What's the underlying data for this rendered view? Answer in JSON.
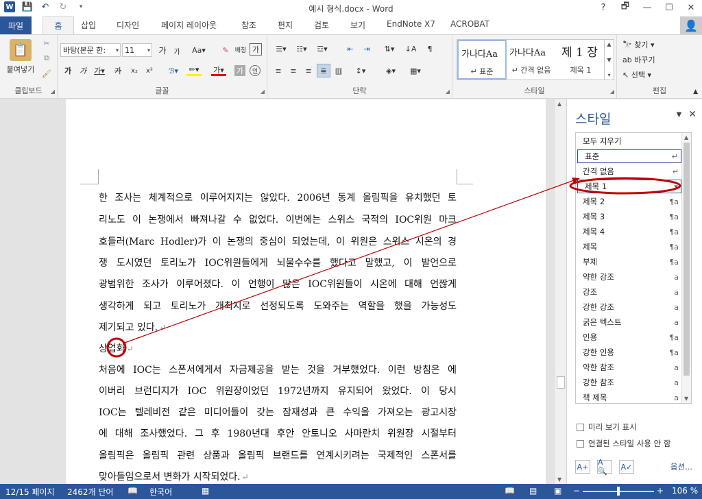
{
  "window": {
    "title": "예시 형식.docx - Word",
    "app_icon": "W",
    "controls": [
      "?",
      "🗗",
      "—",
      "☐",
      "✕"
    ]
  },
  "tabs": [
    "파일",
    "홈",
    "삽입",
    "디자인",
    "페이지 레이아웃",
    "참조",
    "편지",
    "검토",
    "보기",
    "EndNote X7",
    "ACROBAT"
  ],
  "ribbon": {
    "clipboard": {
      "label": "클립보드",
      "paste": "붙여넣기"
    },
    "font": {
      "label": "글꼴",
      "font_name": "바탕(본문 한:",
      "font_size": "11"
    },
    "paragraph": {
      "label": "단락"
    },
    "styles": {
      "label": "스타일",
      "gallery": [
        {
          "sample": "가나다Aa",
          "name": "↵ 표준"
        },
        {
          "sample": "가나다Aa",
          "name": "↵ 간격 없음"
        },
        {
          "sample": "제 1 장",
          "name": "제목 1"
        }
      ]
    },
    "editing": {
      "label": "편집",
      "find": "찾기",
      "replace": "바꾸기",
      "select": "선택"
    }
  },
  "document": {
    "lines": [
      "한 조사는 체계적으로 이루어지지는 않았다. 2006년 동계 올림픽을 유치했던 토",
      "리노도 이 논쟁에서 빠져나갈 수 없었다. 이번에는 스위스 국적의 IOC위원 마크",
      "호들러(Marc Hodler)가 이 논쟁의 중심이 되었는데, 이 위원은 스위스 시온의 경",
      "쟁 도시였던 토리노가 IOC위원들에게 뇌물수수를 했다고 말했고, 이 발언으로",
      "광범위한 조사가 이루어졌다. 이 언행이 많은 IOC위원들이 시온에 대해 언짢게",
      "생각하게 되고 토리노가 개최지로 선정되도록 도와주는 역할을 했을 가능성도",
      "제기되고 있다.",
      "상업화",
      "처음에 IOC는 스폰서에게서 자금제공을 받는 것을 거부했었다. 이런 방침은 에",
      "이버리 브런디지가 IOC 위원장이었던 1972년까지 유지되어 왔었다. 이 당시",
      "IOC는 텔레비전 같은 미디어들이 갖는 잠재성과 큰 수익을 가져오는 광고시장",
      "에 대해 조사했었다. 그 후 1980년대 후안 안토니오 사마란치 위원장 시절부터",
      "올림픽은 올림픽 관련 상품과 올림픽 브랜드를 연계시키려는 국제적인 스폰서를",
      "맞아들임으로서 변화가 시작되었다."
    ]
  },
  "styles_pane": {
    "title": "스타일",
    "items": [
      {
        "name": "모두 지우기",
        "mark": ""
      },
      {
        "name": "표준",
        "mark": "↵"
      },
      {
        "name": "간격 없음",
        "mark": "↵"
      },
      {
        "name": "제목 1",
        "mark": "▾"
      },
      {
        "name": "제목 2",
        "mark": "¶a"
      },
      {
        "name": "제목 3",
        "mark": "¶a"
      },
      {
        "name": "제목 4",
        "mark": "¶a"
      },
      {
        "name": "제목",
        "mark": "¶a"
      },
      {
        "name": "부제",
        "mark": "¶a"
      },
      {
        "name": "약한 강조",
        "mark": "a"
      },
      {
        "name": "강조",
        "mark": "a"
      },
      {
        "name": "강한 강조",
        "mark": "a"
      },
      {
        "name": "굵은 텍스트",
        "mark": "a"
      },
      {
        "name": "인용",
        "mark": "¶a"
      },
      {
        "name": "강한 인용",
        "mark": "¶a"
      },
      {
        "name": "약한 참조",
        "mark": "a"
      },
      {
        "name": "강한 참조",
        "mark": "a"
      },
      {
        "name": "책 제목",
        "mark": "a"
      }
    ],
    "show_preview": "미리 보기 표시",
    "disable_linked": "연결된 스타일 사용 안 함",
    "options": "옵션..."
  },
  "status": {
    "page": "12/15 페이지",
    "words": "2462개 단어",
    "language": "한국어",
    "zoom": "106 %"
  },
  "colors": {
    "accent": "#2b579a",
    "annotation": "#c00000"
  }
}
